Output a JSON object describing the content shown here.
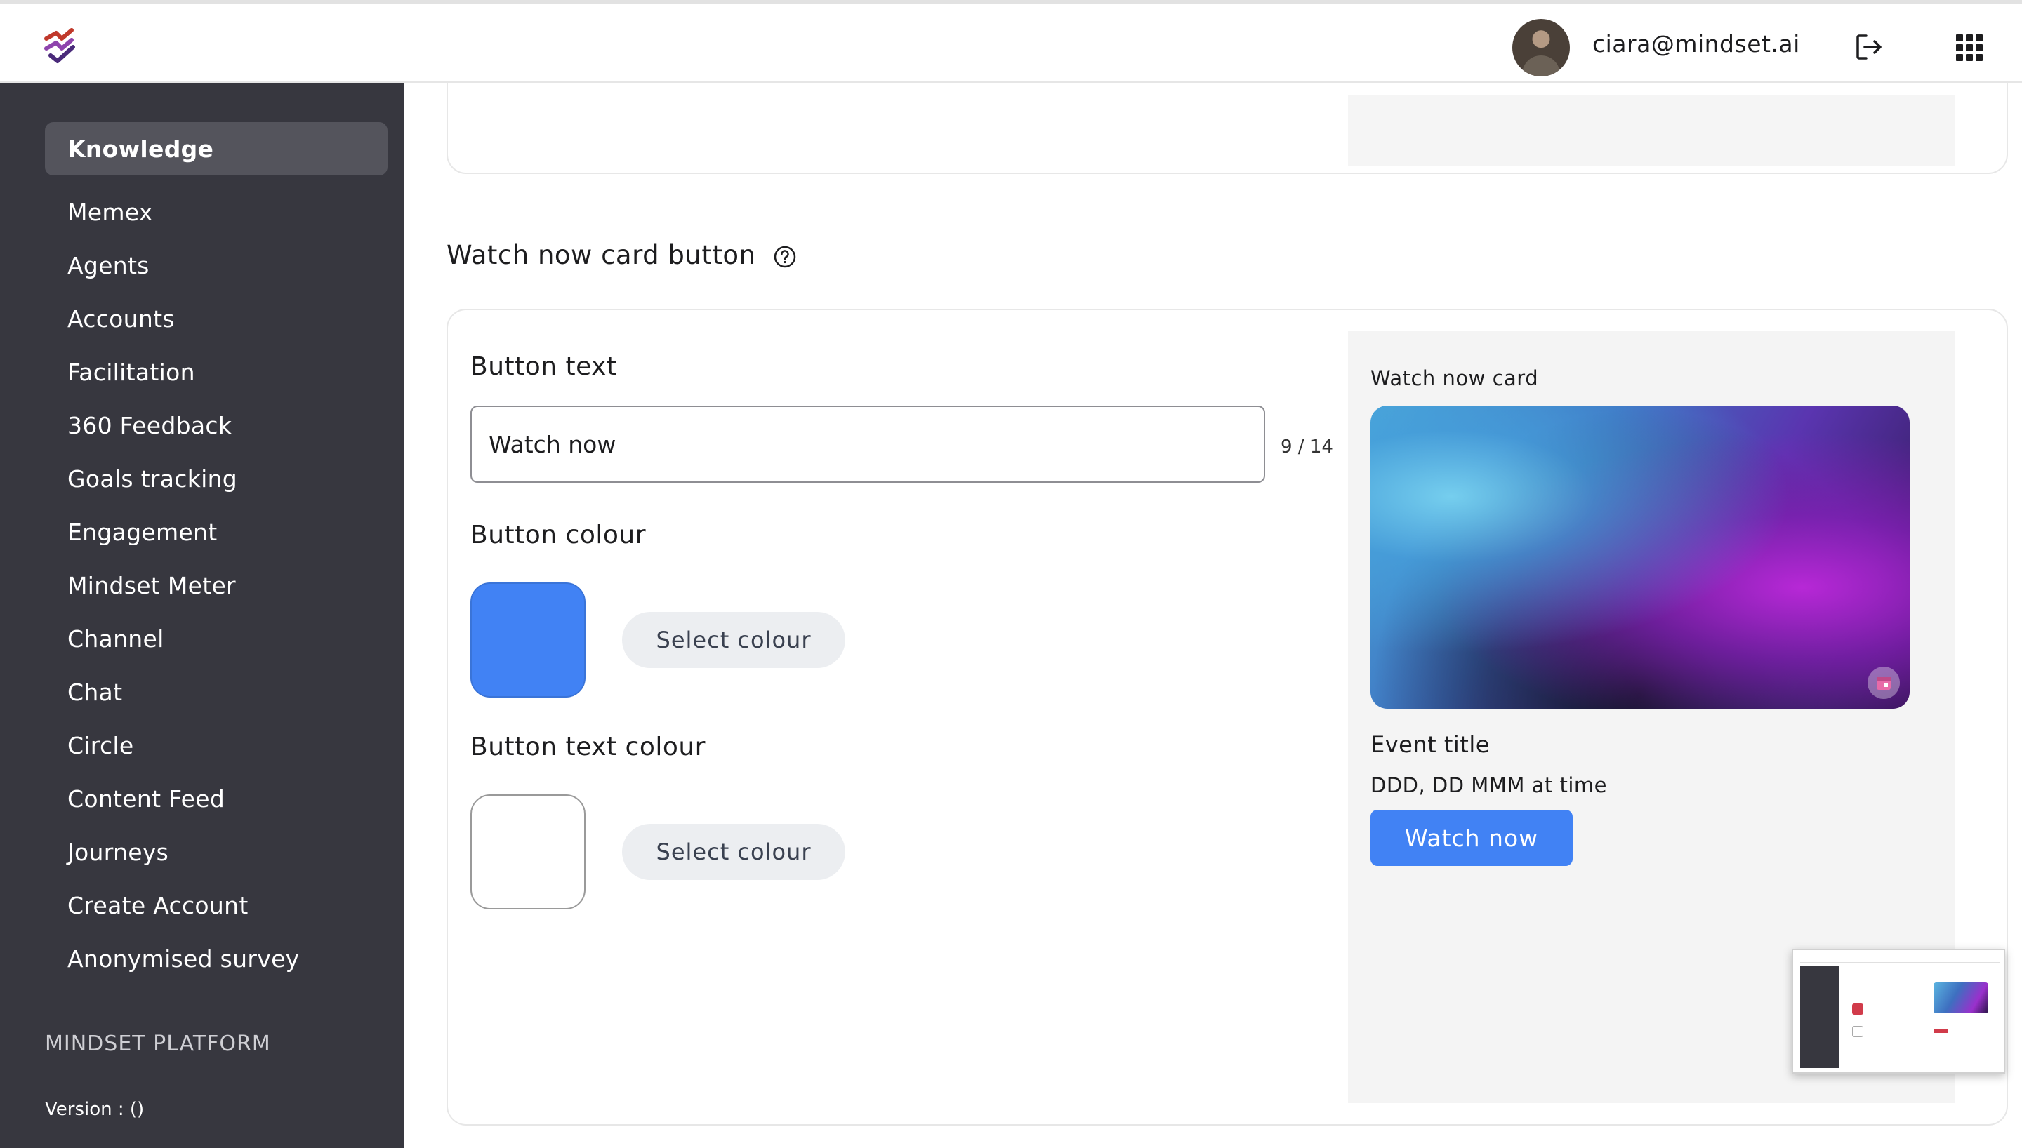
{
  "header": {
    "user_email": "ciara@mindset.ai",
    "logo_icon": "mindset-logo-icon",
    "logout_icon": "logout-icon",
    "apps_icon": "apps-grid-icon"
  },
  "sidebar": {
    "items": [
      {
        "label": "Knowledge",
        "active": true
      },
      {
        "label": "Memex"
      },
      {
        "label": "Agents"
      },
      {
        "label": "Accounts"
      },
      {
        "label": "Facilitation"
      },
      {
        "label": "360 Feedback"
      },
      {
        "label": "Goals tracking"
      },
      {
        "label": "Engagement"
      },
      {
        "label": "Mindset Meter"
      },
      {
        "label": "Channel"
      },
      {
        "label": "Chat"
      },
      {
        "label": "Circle"
      },
      {
        "label": "Content Feed"
      },
      {
        "label": "Journeys"
      },
      {
        "label": "Create Account"
      },
      {
        "label": "Anonymised survey"
      }
    ],
    "platform_label": "MINDSET PLATFORM",
    "version_label": "Version :  ()"
  },
  "section": {
    "title": "Watch now card button",
    "help_icon": "help-circle-icon"
  },
  "form": {
    "button_text_label": "Button text",
    "button_text_value": "Watch now",
    "char_counter": "9 / 14",
    "button_colour_label": "Button colour",
    "button_colour_value": "#4182f4",
    "button_text_colour_label": "Button text colour",
    "button_text_colour_value": "#ffffff",
    "select_colour_label": "Select colour"
  },
  "preview": {
    "label": "Watch now card",
    "event_title": "Event title",
    "event_date": "DDD, DD MMM at time",
    "button_label": "Watch now",
    "calendar_icon": "calendar-icon"
  },
  "colors": {
    "sidebar_bg": "#37373f",
    "accent": "#4182f4"
  }
}
